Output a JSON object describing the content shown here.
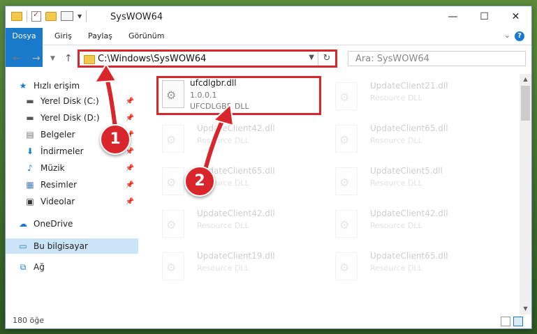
{
  "window": {
    "title": "SysWOW64",
    "controls": {
      "minimize": "—",
      "maximize": "☐",
      "close": "✕"
    }
  },
  "ribbon": {
    "tabs": [
      {
        "label": "Dosya"
      },
      {
        "label": "Giriş"
      },
      {
        "label": "Paylaş"
      },
      {
        "label": "Görünüm"
      }
    ],
    "help": "?"
  },
  "nav": {
    "address": "C:\\Windows\\SysWOW64",
    "search_placeholder": "Ara: SysWOW64"
  },
  "sidebar": {
    "items": [
      {
        "label": "Hızlı erişim",
        "icon": "star-icon",
        "pinned": false
      },
      {
        "label": "Yerel Disk (C:)",
        "icon": "drive-icon",
        "pinned": true
      },
      {
        "label": "Yerel Disk (D:)",
        "icon": "drive-icon",
        "pinned": true
      },
      {
        "label": "Belgeler",
        "icon": "documents-icon",
        "pinned": true
      },
      {
        "label": "İndirmeler",
        "icon": "download-icon",
        "pinned": true
      },
      {
        "label": "Müzik",
        "icon": "music-icon",
        "pinned": true
      },
      {
        "label": "Resimler",
        "icon": "pictures-icon",
        "pinned": true
      },
      {
        "label": "Videolar",
        "icon": "video-icon",
        "pinned": true
      },
      {
        "label": "OneDrive",
        "icon": "cloud-icon",
        "pinned": false
      },
      {
        "label": "Bu bilgisayar",
        "icon": "computer-icon",
        "pinned": false,
        "selected": true
      },
      {
        "label": "Ağ",
        "icon": "network-icon",
        "pinned": false
      }
    ]
  },
  "files": [
    {
      "name": "ufcdlgbr.dll",
      "line2": "1.0.0.1",
      "line3": "UFCDLGBR DLL",
      "highlight": true
    },
    {
      "name": "UpdateClient21.dll",
      "line2": "Resource DLL",
      "line3": ""
    },
    {
      "name": "UpdateClient42.dll",
      "line2": "Resource DLL",
      "line3": ""
    },
    {
      "name": "UpdateClient65.dll",
      "line2": "Resource DLL",
      "line3": ""
    },
    {
      "name": "UpdateClient65.dll",
      "line2": "Resource DLL",
      "line3": ""
    },
    {
      "name": "UpdateClient5.dll",
      "line2": "Resource DLL",
      "line3": ""
    },
    {
      "name": "UpdateClient42.dll",
      "line2": "Resource DLL",
      "line3": ""
    },
    {
      "name": "UpdateClient42.dll",
      "line2": "Resource DLL",
      "line3": ""
    },
    {
      "name": "UpdateClient19.dll",
      "line2": "Resource DLL",
      "line3": ""
    },
    {
      "name": "UpdateClient65.dll",
      "line2": "Resource DLL",
      "line3": ""
    }
  ],
  "status": {
    "count": "180 öğe"
  },
  "annotations": {
    "step1": "1",
    "step2": "2"
  },
  "colors": {
    "accent": "#1979ca",
    "highlight": "#d9262c",
    "selection": "#cce4f7"
  }
}
